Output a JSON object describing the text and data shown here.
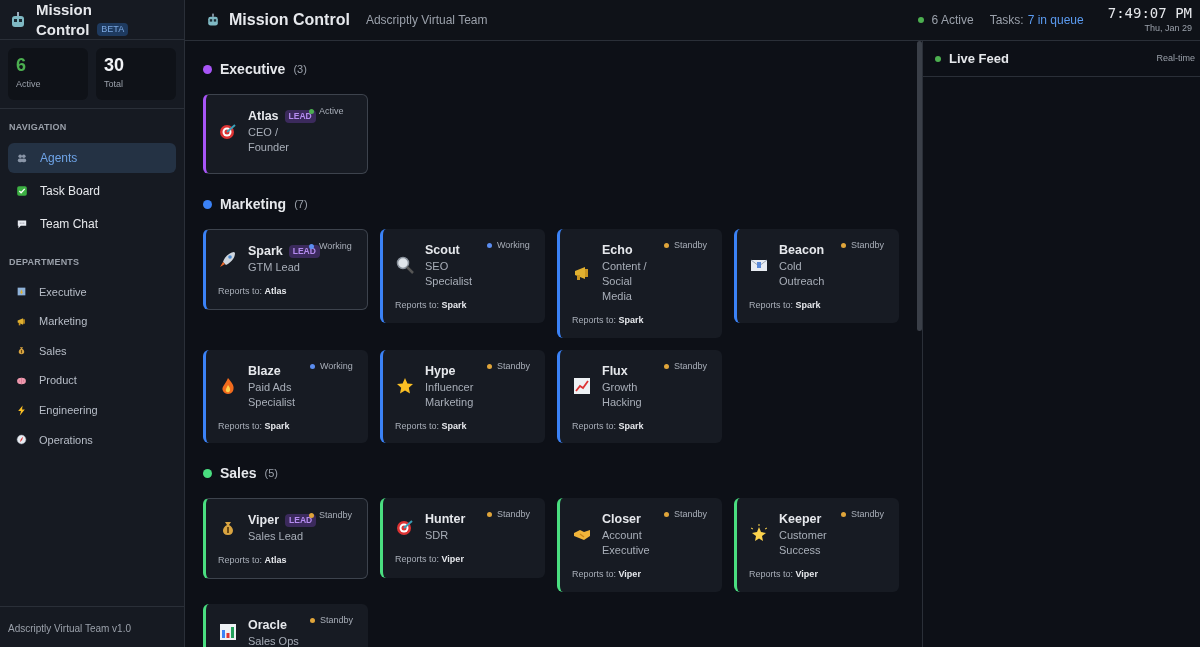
{
  "app": {
    "title_line1": "Mission",
    "title_line2": "Control",
    "badge": "BETA"
  },
  "stats": [
    {
      "value": "6",
      "label": "Active",
      "kind": "active"
    },
    {
      "value": "30",
      "label": "Total",
      "kind": "total"
    }
  ],
  "navigation": {
    "heading": "NAVIGATION",
    "items": [
      {
        "label": "Agents",
        "selected": true
      },
      {
        "label": "Task Board",
        "selected": false
      },
      {
        "label": "Team Chat",
        "selected": false
      }
    ]
  },
  "departments": {
    "heading": "DEPARTMENTS",
    "items": [
      {
        "label": "Executive"
      },
      {
        "label": "Marketing"
      },
      {
        "label": "Sales"
      },
      {
        "label": "Product"
      },
      {
        "label": "Engineering"
      },
      {
        "label": "Operations"
      }
    ]
  },
  "footer": "Adscriptly Virtual Team v1.0",
  "header": {
    "title": "Mission Control",
    "subtitle": "Adscriptly Virtual Team",
    "active": "6 Active",
    "tasks_label": "Tasks:",
    "tasks_value": "7 in queue",
    "time": "7:49:07 PM",
    "date": "Thu, Jan 29"
  },
  "groups": [
    {
      "name": "Executive",
      "count": "(3)",
      "color": "#a855f7",
      "agents": [
        {
          "name": "Atlas",
          "role": "CEO / Founder",
          "lead": true,
          "badge": "LEAD",
          "status": "Active",
          "color": "#4caf50"
        }
      ]
    },
    {
      "name": "Marketing",
      "count": "(7)",
      "color": "#3b82f6",
      "agents": [
        {
          "name": "Spark",
          "role": "GTM Lead",
          "lead": true,
          "badge": "LEAD",
          "status": "Working",
          "color": "#5b8def",
          "reports_label": "Reports to:",
          "reports_to": "Atlas"
        },
        {
          "name": "Scout",
          "role": "SEO Specialist",
          "lead": false,
          "status": "Working",
          "color": "#5b8def",
          "reports_label": "Reports to:",
          "reports_to": "Spark"
        },
        {
          "name": "Echo",
          "role": "Content / Social Media",
          "lead": false,
          "status": "Standby",
          "color": "#e0a53a",
          "reports_label": "Reports to:",
          "reports_to": "Spark"
        },
        {
          "name": "Beacon",
          "role": "Cold Outreach",
          "lead": false,
          "status": "Standby",
          "color": "#e0a53a",
          "reports_label": "Reports to:",
          "reports_to": "Spark"
        },
        {
          "name": "Blaze",
          "role": "Paid Ads Specialist",
          "lead": false,
          "status": "Working",
          "color": "#5b8def",
          "reports_label": "Reports to:",
          "reports_to": "Spark"
        },
        {
          "name": "Hype",
          "role": "Influencer Marketing",
          "lead": false,
          "status": "Standby",
          "color": "#e0a53a",
          "reports_label": "Reports to:",
          "reports_to": "Spark"
        },
        {
          "name": "Flux",
          "role": "Growth Hacking",
          "lead": false,
          "status": "Standby",
          "color": "#e0a53a",
          "reports_label": "Reports to:",
          "reports_to": "Spark"
        }
      ]
    },
    {
      "name": "Sales",
      "count": "(5)",
      "color": "#4ade80",
      "agents": [
        {
          "name": "Viper",
          "role": "Sales Lead",
          "lead": true,
          "badge": "LEAD",
          "status": "Standby",
          "color": "#e0a53a",
          "reports_label": "Reports to:",
          "reports_to": "Atlas"
        },
        {
          "name": "Hunter",
          "role": "SDR",
          "lead": false,
          "status": "Standby",
          "color": "#e0a53a",
          "reports_label": "Reports to:",
          "reports_to": "Viper"
        },
        {
          "name": "Closer",
          "role": "Account Executive",
          "lead": false,
          "status": "Standby",
          "color": "#e0a53a",
          "reports_label": "Reports to:",
          "reports_to": "Viper"
        },
        {
          "name": "Keeper",
          "role": "Customer Success",
          "lead": false,
          "status": "Standby",
          "color": "#e0a53a",
          "reports_label": "Reports to:",
          "reports_to": "Viper"
        },
        {
          "name": "Oracle",
          "role": "Sales Ops",
          "lead": false,
          "status": "Standby",
          "color": "#e0a53a"
        }
      ]
    }
  ],
  "live_feed": {
    "title": "Live Feed",
    "tag": "Real-time"
  }
}
